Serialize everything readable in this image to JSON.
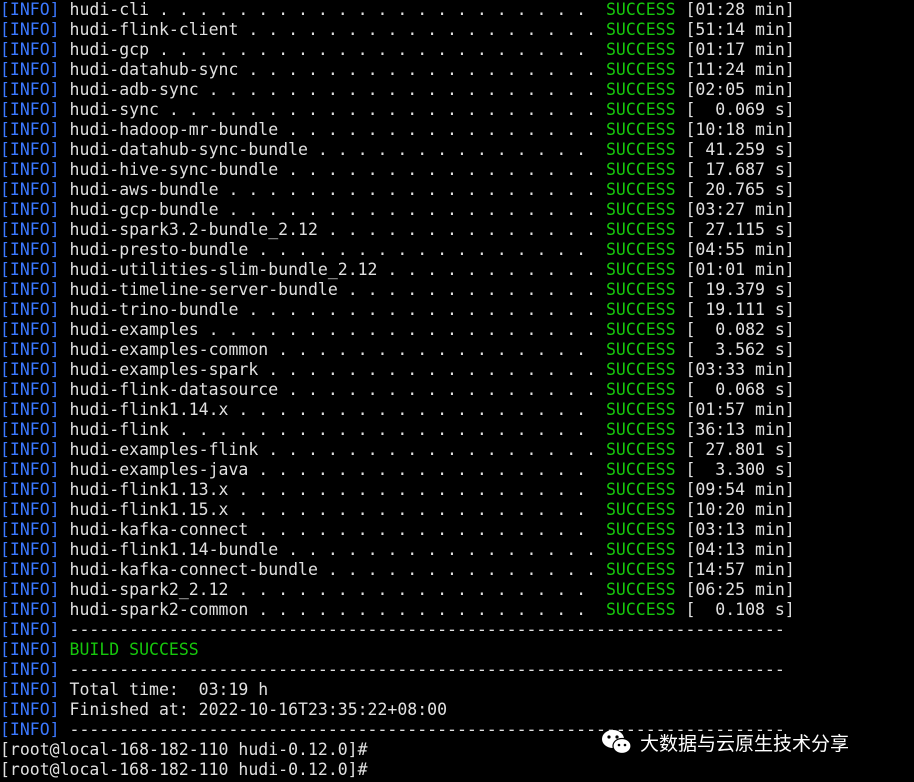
{
  "tag": "[INFO]",
  "modules": [
    {
      "name": "hudi-cli",
      "status": "SUCCESS",
      "time": "[01:28 min]"
    },
    {
      "name": "hudi-flink-client",
      "status": "SUCCESS",
      "time": "[51:14 min]"
    },
    {
      "name": "hudi-gcp",
      "status": "SUCCESS",
      "time": "[01:17 min]"
    },
    {
      "name": "hudi-datahub-sync",
      "status": "SUCCESS",
      "time": "[11:24 min]"
    },
    {
      "name": "hudi-adb-sync",
      "status": "SUCCESS",
      "time": "[02:05 min]"
    },
    {
      "name": "hudi-sync",
      "status": "SUCCESS",
      "time": "[  0.069 s]"
    },
    {
      "name": "hudi-hadoop-mr-bundle",
      "status": "SUCCESS",
      "time": "[10:18 min]"
    },
    {
      "name": "hudi-datahub-sync-bundle",
      "status": "SUCCESS",
      "time": "[ 41.259 s]"
    },
    {
      "name": "hudi-hive-sync-bundle",
      "status": "SUCCESS",
      "time": "[ 17.687 s]"
    },
    {
      "name": "hudi-aws-bundle",
      "status": "SUCCESS",
      "time": "[ 20.765 s]"
    },
    {
      "name": "hudi-gcp-bundle",
      "status": "SUCCESS",
      "time": "[03:27 min]"
    },
    {
      "name": "hudi-spark3.2-bundle_2.12",
      "status": "SUCCESS",
      "time": "[ 27.115 s]"
    },
    {
      "name": "hudi-presto-bundle",
      "status": "SUCCESS",
      "time": "[04:55 min]"
    },
    {
      "name": "hudi-utilities-slim-bundle_2.12",
      "status": "SUCCESS",
      "time": "[01:01 min]"
    },
    {
      "name": "hudi-timeline-server-bundle",
      "status": "SUCCESS",
      "time": "[ 19.379 s]"
    },
    {
      "name": "hudi-trino-bundle",
      "status": "SUCCESS",
      "time": "[ 19.111 s]"
    },
    {
      "name": "hudi-examples",
      "status": "SUCCESS",
      "time": "[  0.082 s]"
    },
    {
      "name": "hudi-examples-common",
      "status": "SUCCESS",
      "time": "[  3.562 s]"
    },
    {
      "name": "hudi-examples-spark",
      "status": "SUCCESS",
      "time": "[03:33 min]"
    },
    {
      "name": "hudi-flink-datasource",
      "status": "SUCCESS",
      "time": "[  0.068 s]"
    },
    {
      "name": "hudi-flink1.14.x",
      "status": "SUCCESS",
      "time": "[01:57 min]"
    },
    {
      "name": "hudi-flink",
      "status": "SUCCESS",
      "time": "[36:13 min]"
    },
    {
      "name": "hudi-examples-flink",
      "status": "SUCCESS",
      "time": "[ 27.801 s]"
    },
    {
      "name": "hudi-examples-java",
      "status": "SUCCESS",
      "time": "[  3.300 s]"
    },
    {
      "name": "hudi-flink1.13.x",
      "status": "SUCCESS",
      "time": "[09:54 min]"
    },
    {
      "name": "hudi-flink1.15.x",
      "status": "SUCCESS",
      "time": "[10:20 min]"
    },
    {
      "name": "hudi-kafka-connect",
      "status": "SUCCESS",
      "time": "[03:13 min]"
    },
    {
      "name": "hudi-flink1.14-bundle",
      "status": "SUCCESS",
      "time": "[04:13 min]"
    },
    {
      "name": "hudi-kafka-connect-bundle",
      "status": "SUCCESS",
      "time": "[14:57 min]"
    },
    {
      "name": "hudi-spark2_2.12",
      "status": "SUCCESS",
      "time": "[06:25 min]"
    },
    {
      "name": "hudi-spark2-common",
      "status": "SUCCESS",
      "time": "[  0.108 s]"
    }
  ],
  "separator": "------------------------------------------------------------------------",
  "build_result": "BUILD SUCCESS",
  "total_time": "Total time:  03:19 h",
  "finished_at": "Finished at: 2022-10-16T23:35:22+08:00",
  "prompts": [
    "[root@local-168-182-110 hudi-0.12.0]#",
    "[root@local-168-182-110 hudi-0.12.0]#"
  ],
  "watermark": {
    "text": "大数据与云原生技术分享",
    "icon": "wechat-icon"
  },
  "colors": {
    "background": "#000000",
    "info_tag": "#3b78ff",
    "text": "#e0e0e0",
    "success": "#16c60c"
  }
}
